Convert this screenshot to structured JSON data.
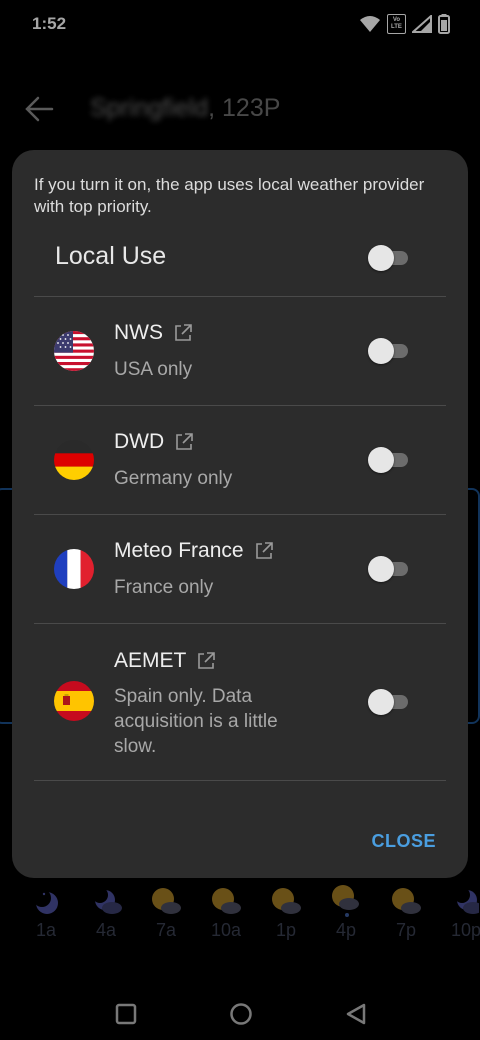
{
  "status_bar": {
    "time": "1:52",
    "network_label": "Vo LTE"
  },
  "app_bar": {
    "title_blurred": "Springfield",
    "title_suffix": ", 123P"
  },
  "forecast": [
    {
      "label": "1a",
      "icon": "moon-icon"
    },
    {
      "label": "4a",
      "icon": "moon-cloud-icon"
    },
    {
      "label": "7a",
      "icon": "sun-cloud-icon"
    },
    {
      "label": "10a",
      "icon": "sun-cloud-icon"
    },
    {
      "label": "1p",
      "icon": "sun-cloud-icon"
    },
    {
      "label": "4p",
      "icon": "sun-rain-icon"
    },
    {
      "label": "7p",
      "icon": "sun-cloud-icon"
    },
    {
      "label": "10p",
      "icon": "moon-cloud-icon"
    }
  ],
  "dialog": {
    "description": "If you turn it on, the app uses local weather provider with top priority.",
    "local_use": {
      "label": "Local Use",
      "enabled": false
    },
    "providers": [
      {
        "name": "NWS",
        "description": "USA only",
        "enabled": false,
        "flag": "usa-flag-icon"
      },
      {
        "name": "DWD",
        "description": "Germany only",
        "enabled": false,
        "flag": "germany-flag-icon"
      },
      {
        "name": "Meteo France",
        "description": "France only",
        "enabled": false,
        "flag": "france-flag-icon"
      },
      {
        "name": "AEMET",
        "description": "Spain only. Data acquisition is a little slow.",
        "enabled": false,
        "flag": "spain-flag-icon"
      }
    ],
    "close_label": "CLOSE"
  },
  "colors": {
    "accent": "#4a9ee0",
    "dialog_bg": "#2c2c2c",
    "divider": "#4a4a4a"
  }
}
